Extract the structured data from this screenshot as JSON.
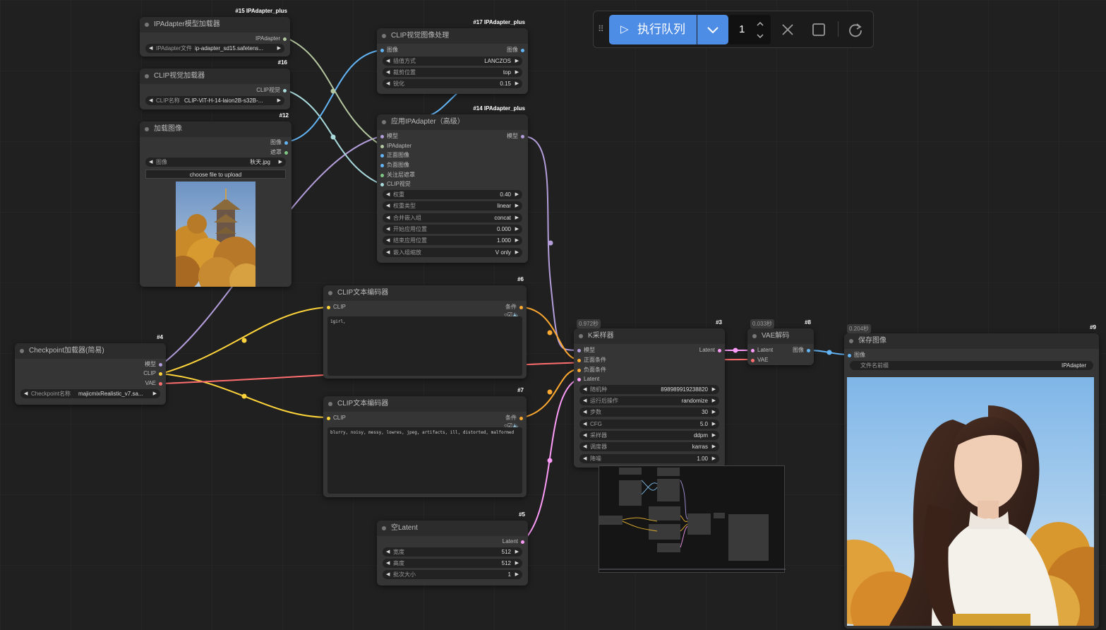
{
  "toolbar": {
    "run_label": "执行队列",
    "batch_count": "1"
  },
  "nodes": {
    "n15": {
      "badge": "#15 IPAdapter_plus",
      "title": "IPAdapter模型加载器",
      "out_ipadapter": "IPAdapter",
      "w_label": "IPAdapter文件",
      "w_value": "ip-adapter_sd15.safetens..."
    },
    "n16": {
      "badge": "#16",
      "title": "CLIP视觉加载器",
      "out_clipvision": "CLIP视觉",
      "w_label": "CLIP名称",
      "w_value": "CLIP-ViT-H-14-laion2B-s32B-..."
    },
    "n12": {
      "badge": "#12",
      "title": "加载图像",
      "out_image": "图像",
      "out_mask": "遮罩",
      "w_label": "图像",
      "w_value": "秋天.jpg",
      "upload": "choose file to upload"
    },
    "n17": {
      "badge": "#17 IPAdapter_plus",
      "title": "CLIP视觉图像处理",
      "in_image": "图像",
      "out_image": "图像",
      "widgets": [
        {
          "label": "插值方式",
          "value": "LANCZOS"
        },
        {
          "label": "裁剪位置",
          "value": "top"
        },
        {
          "label": "锐化",
          "value": "0.15"
        }
      ]
    },
    "n14": {
      "badge": "#14 IPAdapter_plus",
      "title": "应用IPAdapter（高级）",
      "inputs": [
        "模型",
        "IPAdapter",
        "正面图像",
        "负面图像",
        "关注层遮罩",
        "CLIP视觉"
      ],
      "out_model": "模型",
      "widgets": [
        {
          "label": "权重",
          "value": "0.40"
        },
        {
          "label": "权重类型",
          "value": "linear"
        },
        {
          "label": "合并嵌入组",
          "value": "concat"
        },
        {
          "label": "开始应用位置",
          "value": "0.000"
        },
        {
          "label": "结束应用位置",
          "value": "1.000"
        },
        {
          "label": "嵌入组缩放",
          "value": "V only"
        }
      ]
    },
    "n6": {
      "badge": "#6",
      "title": "CLIP文本编码器",
      "in_clip": "CLIP",
      "out_cond": "条件",
      "text": "1girl,"
    },
    "n7": {
      "badge": "#7",
      "title": "CLIP文本编码器",
      "in_clip": "CLIP",
      "out_cond": "条件",
      "text": "blurry, noisy, messy, lowres, jpeg, artifacts, ill, distorted, malformed"
    },
    "n4": {
      "badge": "#4",
      "title": "Checkpoint加载器(简易)",
      "out_model": "模型",
      "out_clip": "CLIP",
      "out_vae": "VAE",
      "w_label": "Checkpoint名称",
      "w_value": "majicmixRealistic_v7.sa..."
    },
    "n3": {
      "badge": "#3",
      "timer": "0.972秒",
      "title": "K采样器",
      "inputs": [
        "模型",
        "正面条件",
        "负面条件",
        "Latent"
      ],
      "out_latent": "Latent",
      "widgets": [
        {
          "label": "随机种",
          "value": "898989919238820"
        },
        {
          "label": "运行后操作",
          "value": "randomize"
        },
        {
          "label": "步数",
          "value": "30"
        },
        {
          "label": "CFG",
          "value": "5.0"
        },
        {
          "label": "采样器",
          "value": "ddpm"
        },
        {
          "label": "调度器",
          "value": "karras"
        },
        {
          "label": "降噪",
          "value": "1.00"
        }
      ]
    },
    "n8": {
      "badge": "#8",
      "timer": "0.033秒",
      "title": "VAE解码",
      "in_latent": "Latent",
      "in_vae": "VAE",
      "out_image": "图像"
    },
    "n9": {
      "badge": "#9",
      "timer": "0.204秒",
      "title": "保存图像",
      "in_image": "图像",
      "w_label": "文件名前缀",
      "w_value": "IPAdapter"
    },
    "n5": {
      "badge": "#5",
      "title": "空Latent",
      "out_latent": "Latent",
      "widgets": [
        {
          "label": "宽度",
          "value": "512"
        },
        {
          "label": "高度",
          "value": "512"
        },
        {
          "label": "批次大小",
          "value": "1"
        }
      ]
    }
  },
  "colors": {
    "model": "#b39ddb",
    "clip": "#ffd43b",
    "vae": "#ff6e6e",
    "cond": "#ffa931",
    "latent": "#ff9cf9",
    "image": "#64b5f6",
    "clipvision": "#a8dadc",
    "ipadapter": "#b5c7a0",
    "accent": "#4e8de6"
  }
}
